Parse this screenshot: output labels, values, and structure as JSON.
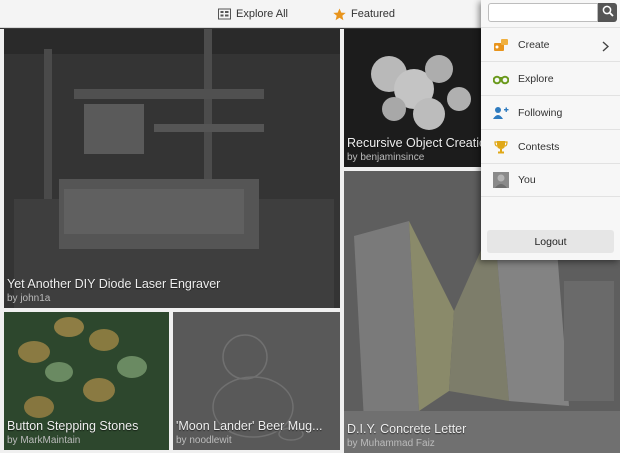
{
  "topbar": {
    "explore_all_label": "Explore All",
    "featured_label": "Featured"
  },
  "tiles": [
    {
      "title": "Yet Another DIY Diode Laser Engraver",
      "author": "by john1a"
    },
    {
      "title": "Recursive Object Creation",
      "author": "by benjaminsince"
    },
    {
      "title": "D.I.Y. Concrete Letter",
      "author": "by Muhammad Faiz"
    },
    {
      "title": "Button Stepping Stones",
      "author": "by MarkMaintain"
    },
    {
      "title": "'Moon Lander' Beer Mug...",
      "author": "by noodlewit"
    }
  ],
  "panel": {
    "search_placeholder": "",
    "search_value": "",
    "menu": [
      {
        "label": "Create",
        "icon": "create-icon",
        "has_chevron": true
      },
      {
        "label": "Explore",
        "icon": "explore-icon"
      },
      {
        "label": "Following",
        "icon": "following-icon"
      },
      {
        "label": "Contests",
        "icon": "trophy-icon"
      },
      {
        "label": "You",
        "icon": "avatar"
      }
    ],
    "logout_label": "Logout"
  },
  "colors": {
    "accent_orange": "#e8941c",
    "explore_green": "#6b9a1e",
    "following_blue": "#2e7bbf",
    "trophy_gold": "#e0a817"
  }
}
